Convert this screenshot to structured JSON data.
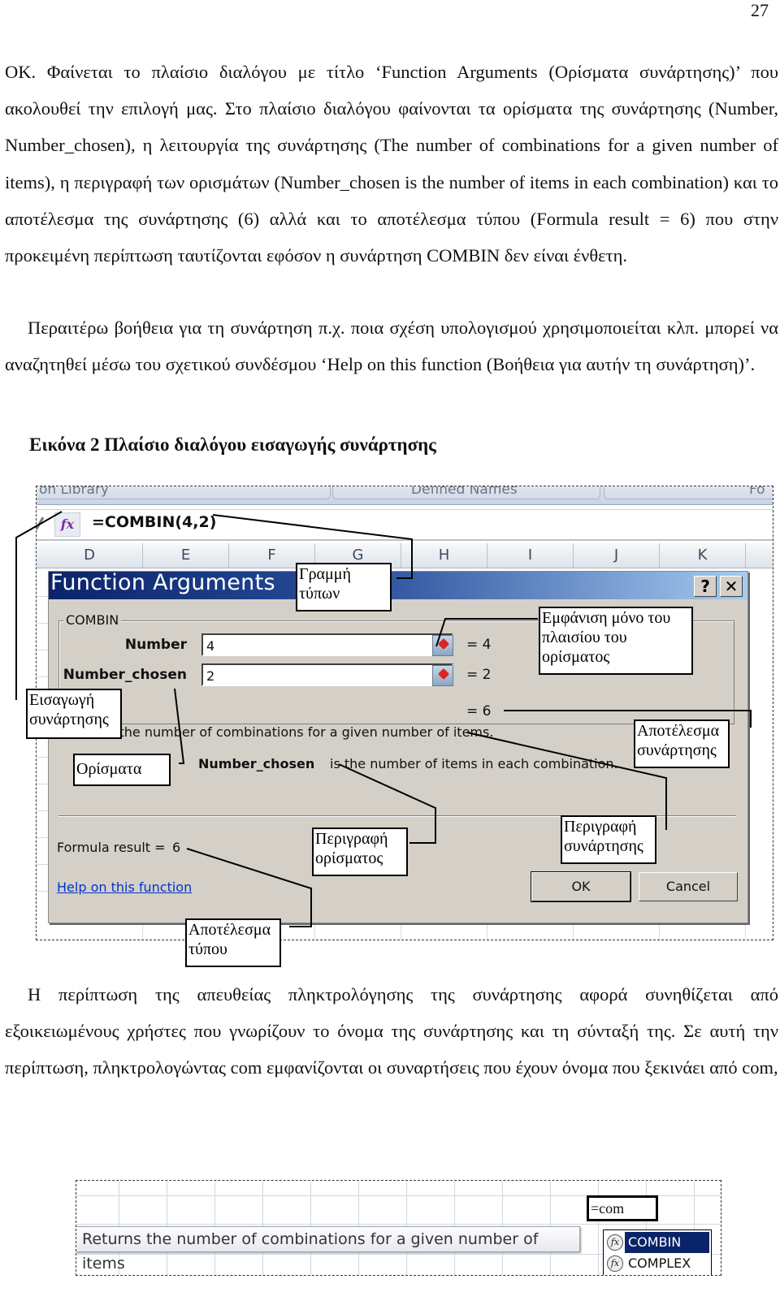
{
  "page_number": "27",
  "paragraphs": [
    "ΟΚ.   Φαίνεται το πλαίσιο διαλόγου με τίτλο ‘Function Arguments (Ορίσματα συνάρτησης)’ που ακολουθεί την επιλογή μας.  Στο πλαίσιο διαλόγου φαίνονται τα ορίσματα της συνάρτησης (Number, Number_chosen), η λειτουργία της συνάρτησης (The number of combinations for a given number of items), η περιγραφή των ορισμάτων (Number_chosen is the number of items in each combination) και το αποτέλεσμα της συνάρτησης (6) αλλά και το αποτέλεσμα τύπου (Formula result = 6) που στην προκειμένη περίπτωση ταυτίζονται εφόσον η συνάρτηση COMBIN δεν είναι ένθετη.",
    "Περαιτέρω βοήθεια για τη συνάρτηση π.χ. ποια σχέση υπολογισμού χρησιμοποιείται κλπ. μπορεί να αναζητηθεί μέσω του σχετικού συνδέσμου ‘Help on this function (Βοήθεια για αυτήν τη συνάρτηση)’.",
    "Η περίπτωση της απευθείας πληκτρολόγησης της συνάρτησης αφορά συνηθίζεται από εξοικειωμένους χρήστες που γνωρίζουν το όνομα της συνάρτησης και τη σύνταξή της. Σε αυτή την περίπτωση, πληκτρολογώντας com εμφανίζονται οι συναρτήσεις που έχουν όνομα που ξεκινάει από com,"
  ],
  "figure_caption": "Εικόνα 2 Πλαίσιο διαλόγου εισαγωγής συνάρτησης",
  "excel": {
    "ribbon_groups": [
      "on Library",
      "Defined Names",
      "Fo"
    ],
    "fx_icon": "fx",
    "formula": "=COMBIN(4,2)",
    "columns": [
      "D",
      "E",
      "F",
      "G",
      "H",
      "I",
      "J",
      "K"
    ]
  },
  "dialog": {
    "title": "Function Arguments",
    "help_btn": "?",
    "close_btn": "✕",
    "function_name": "COMBIN",
    "args": [
      {
        "label": "Number",
        "value": "4",
        "result": "=  4"
      },
      {
        "label": "Number_chosen",
        "value": "2",
        "result": "=  2"
      }
    ],
    "function_result": "=  6",
    "function_description": "Returns the number of combinations for a given number of items.",
    "arg_desc_name": "Number_chosen",
    "arg_desc_text": "is the number of items in each combination.",
    "formula_result_label": "Formula result =",
    "formula_result_value": "6",
    "help_link": "Help on this function",
    "ok": "OK",
    "cancel": "Cancel"
  },
  "callouts": {
    "formula_bar": "Γραμμή τύπων",
    "collapse_dialog": "Εμφάνιση μόνο του πλαισίου του ορίσματος",
    "insert_function": "Εισαγωγή συνάρτησης",
    "function_result": "Αποτέλεσμα συνάρτησης",
    "arguments": "Ορίσματα",
    "arg_description": "Περιγραφή ορίσματος",
    "function_description": "Περιγραφή συνάρτησης",
    "formula_result": "Αποτέλεσμα τύπου"
  },
  "figure2": {
    "cell_text": "=com",
    "tooltip": "Returns the number of combinations for a given number of items",
    "autocomplete": [
      {
        "name": "COMBIN",
        "selected": true
      },
      {
        "name": "COMPLEX",
        "selected": false
      }
    ]
  },
  "colors": {
    "title_start": "#0a246a",
    "title_end": "#a6caf0",
    "dialog_bg": "#d4d0c8",
    "link": "#0033cc",
    "fx_purple": "#7b2ea8"
  }
}
